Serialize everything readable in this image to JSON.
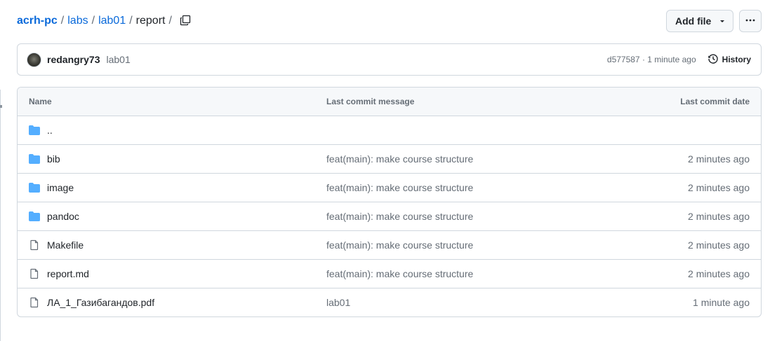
{
  "breadcrumb": {
    "repo": "acrh-pc",
    "folder1": "labs",
    "folder2": "lab01",
    "current": "report",
    "sep": "/"
  },
  "actions": {
    "add_file": "Add file",
    "more": "···"
  },
  "latest_commit": {
    "author": "redangry73",
    "message": "lab01",
    "meta": "d577587 · 1 minute ago",
    "history": "History"
  },
  "table": {
    "headers": {
      "name": "Name",
      "message": "Last commit message",
      "date": "Last commit date"
    },
    "rows": [
      {
        "type": "folder",
        "name": "..",
        "message": "",
        "date": ""
      },
      {
        "type": "folder",
        "name": "bib",
        "message": "feat(main): make course structure",
        "date": "2 minutes ago"
      },
      {
        "type": "folder",
        "name": "image",
        "message": "feat(main): make course structure",
        "date": "2 minutes ago"
      },
      {
        "type": "folder",
        "name": "pandoc",
        "message": "feat(main): make course structure",
        "date": "2 minutes ago"
      },
      {
        "type": "file",
        "name": "Makefile",
        "message": "feat(main): make course structure",
        "date": "2 minutes ago"
      },
      {
        "type": "file",
        "name": "report.md",
        "message": "feat(main): make course structure",
        "date": "2 minutes ago"
      },
      {
        "type": "file",
        "name": "ЛА_1_Газибагандов.pdf",
        "message": "lab01",
        "date": "1 minute ago"
      }
    ]
  },
  "colors": {
    "link": "#0969da",
    "folder_icon": "#54aeff",
    "muted": "#656d76",
    "border": "#d0d7de"
  }
}
